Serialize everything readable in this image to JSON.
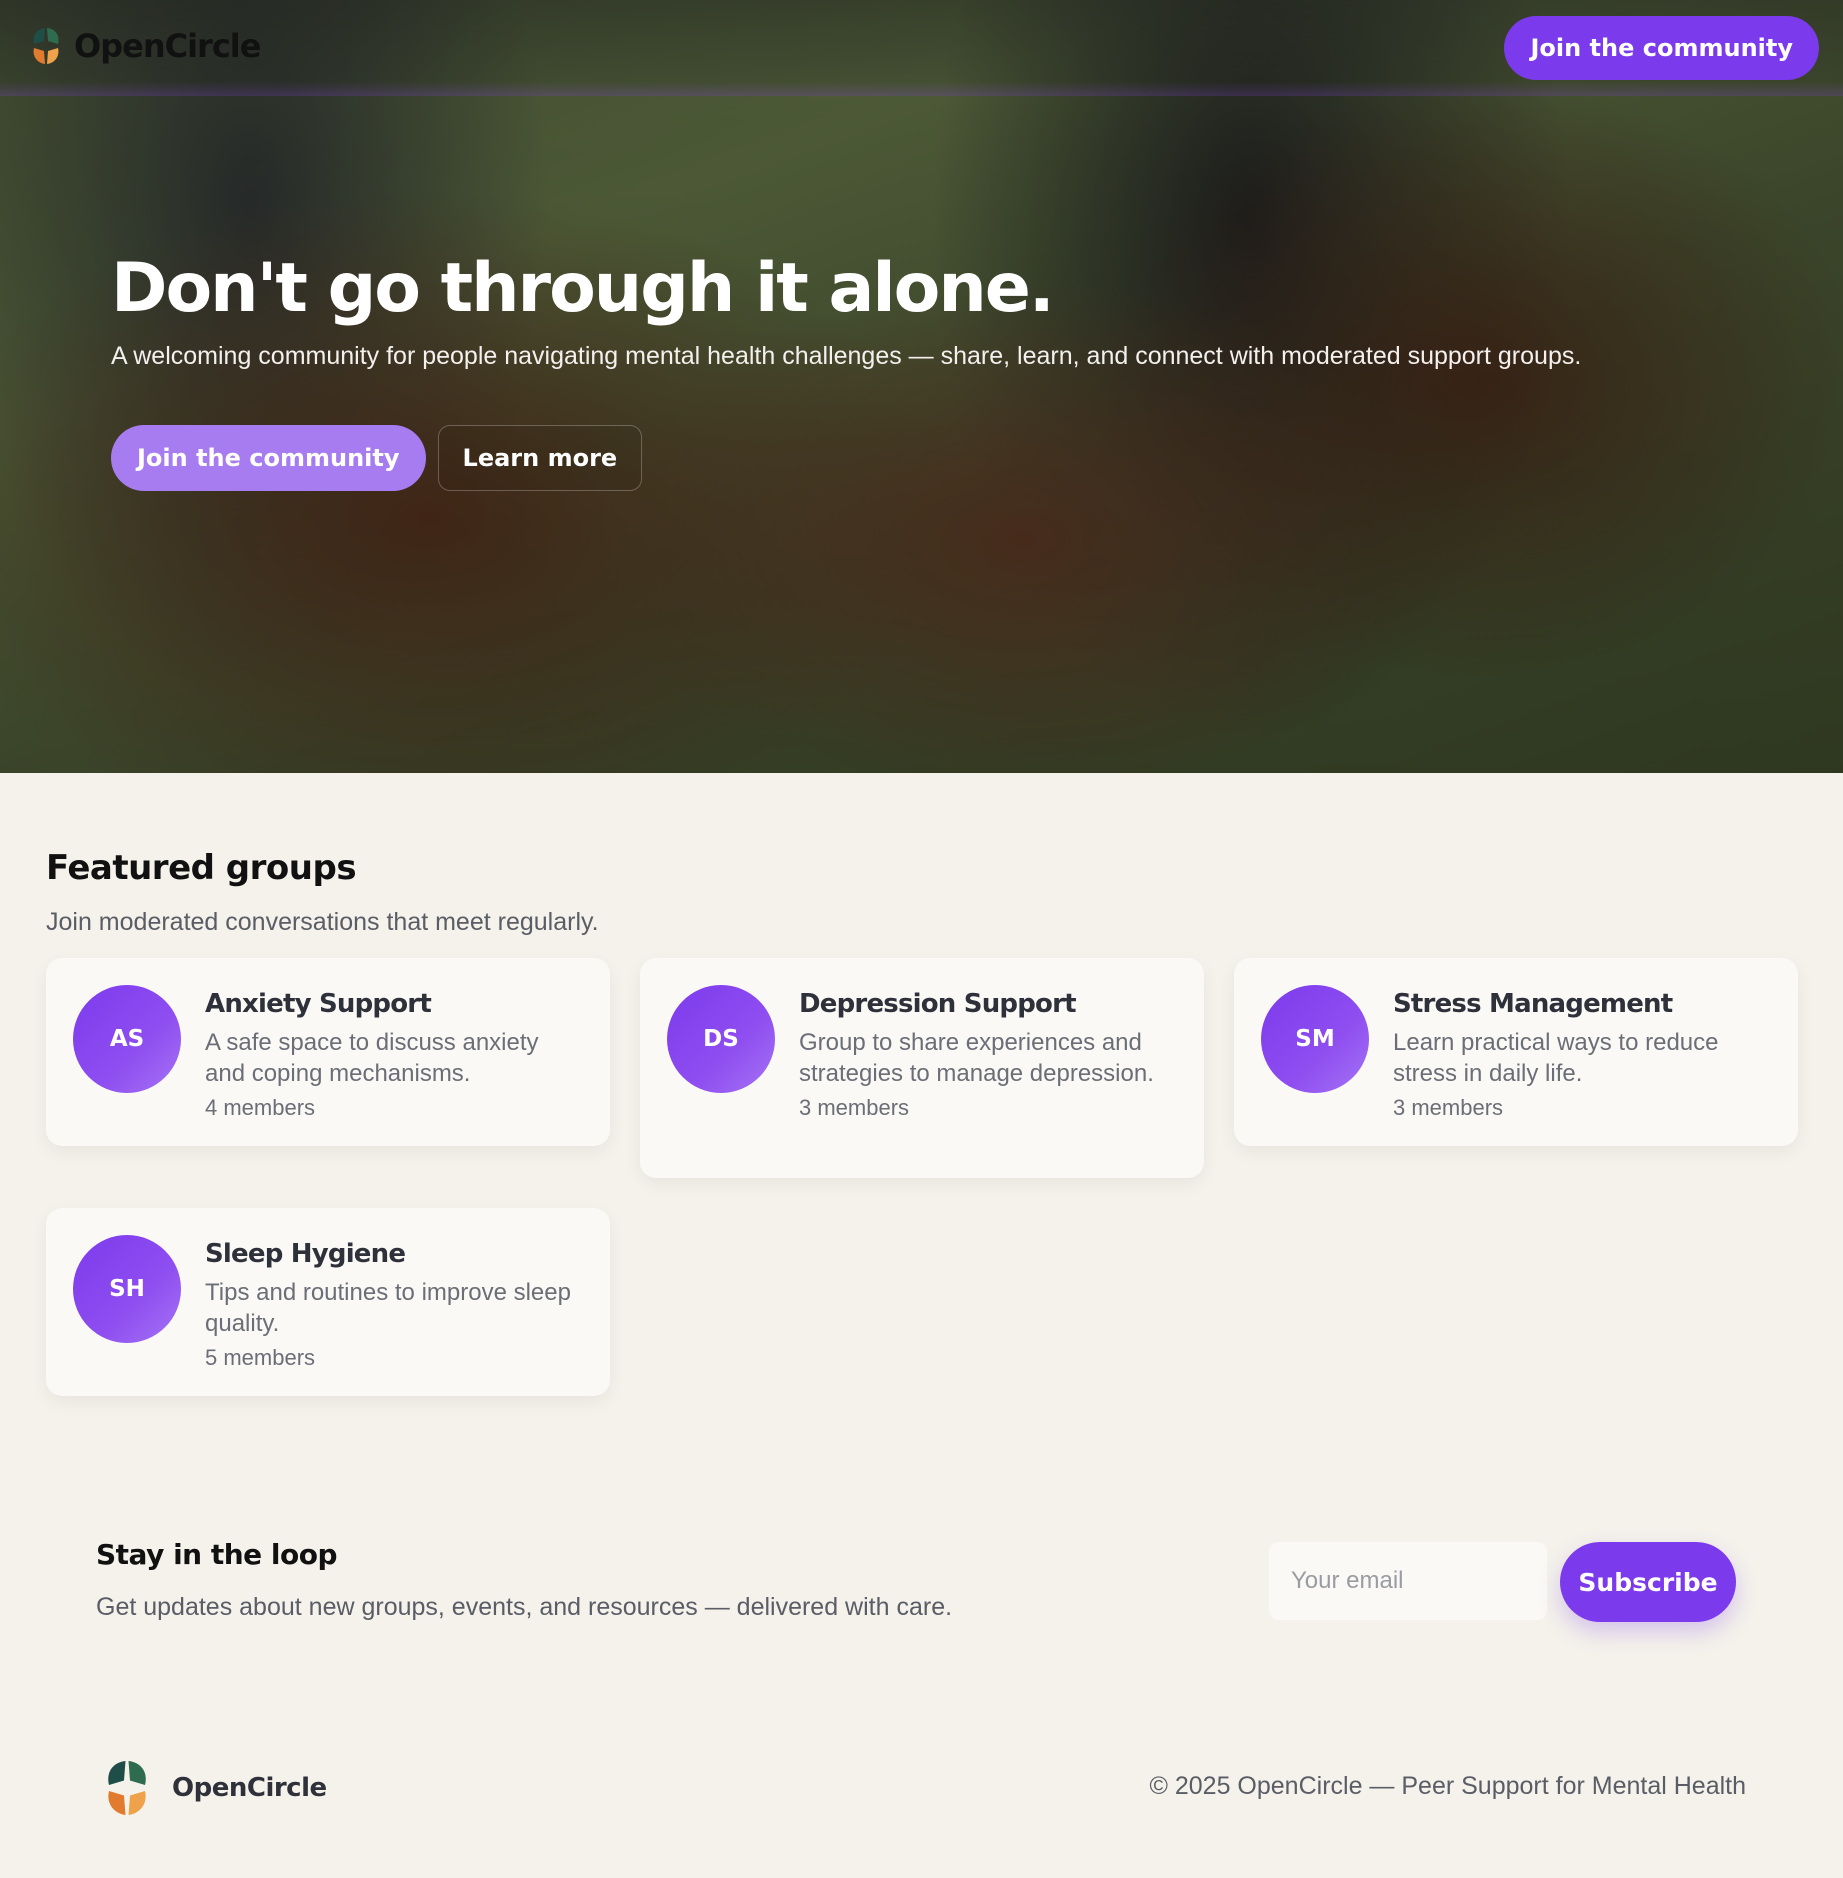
{
  "brand": {
    "name": "OpenCircle"
  },
  "header": {
    "cta_label": "Join the community"
  },
  "hero": {
    "title": "Don't go through it alone.",
    "subtitle": "A welcoming community for people navigating mental health challenges — share, learn, and connect with moderated support groups.",
    "primary_label": "Join the community",
    "secondary_label": "Learn more"
  },
  "featured": {
    "title": "Featured groups",
    "subtitle": "Join moderated conversations that meet regularly.",
    "groups": [
      {
        "initials": "AS",
        "name": "Anxiety Support",
        "description": "A safe space to discuss anxiety and coping mechanisms.",
        "members": "4 members"
      },
      {
        "initials": "DS",
        "name": "Depression Support",
        "description": "Group to share experiences and strategies to manage depression.",
        "members": "3 members"
      },
      {
        "initials": "SM",
        "name": "Stress Management",
        "description": "Learn practical ways to reduce stress in daily life.",
        "members": "3 members"
      },
      {
        "initials": "SH",
        "name": "Sleep Hygiene",
        "description": "Tips and routines to improve sleep quality.",
        "members": "5 members"
      }
    ]
  },
  "newsletter": {
    "title": "Stay in the loop",
    "description": "Get updates about new groups, events, and resources — delivered with care.",
    "email_placeholder": "Your email",
    "subscribe_label": "Subscribe"
  },
  "footer": {
    "copyright": "© 2025 OpenCircle — Peer Support for Mental Health"
  },
  "colors": {
    "accent": "#7c3aed",
    "accent_light": "#a77cf0",
    "background": "#f4f2eb",
    "card": "#faf9f6",
    "logo_teal": "#1f4d48",
    "logo_green": "#2f6b4f",
    "logo_orange": "#e07b2f",
    "logo_amber": "#f0a24a"
  },
  "icons": {
    "logo": "opencircle-logo-icon"
  }
}
